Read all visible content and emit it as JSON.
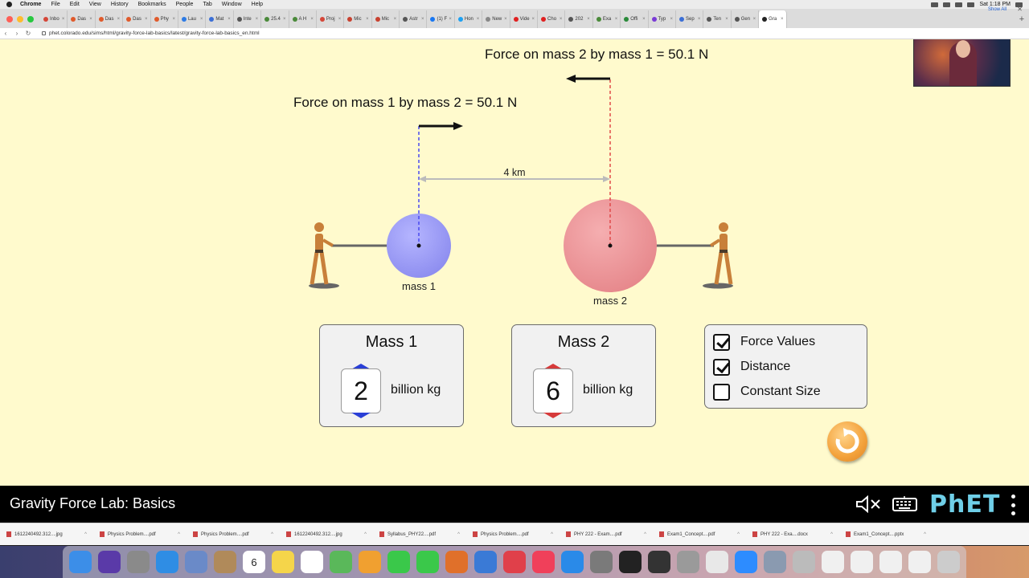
{
  "menubar": {
    "app": "Chrome",
    "items": [
      "File",
      "Edit",
      "View",
      "History",
      "Bookmarks",
      "People",
      "Tab",
      "Window",
      "Help"
    ],
    "clock": "Sat 1:18 PM"
  },
  "tabs": [
    {
      "label": "Inbo",
      "color": "#d44638"
    },
    {
      "label": "Das",
      "color": "#e05a2b"
    },
    {
      "label": "Das",
      "color": "#e05a2b"
    },
    {
      "label": "Das",
      "color": "#e05a2b"
    },
    {
      "label": "Phy",
      "color": "#e05a2b"
    },
    {
      "label": "Lau",
      "color": "#2d7be5"
    },
    {
      "label": "Mat",
      "color": "#3b6fd6"
    },
    {
      "label": "Inte",
      "color": "#555555"
    },
    {
      "label": "25.4",
      "color": "#4a8a3a"
    },
    {
      "label": "A H",
      "color": "#4a8a3a"
    },
    {
      "label": "Proj",
      "color": "#d44638"
    },
    {
      "label": "Mic",
      "color": "#c8412f"
    },
    {
      "label": "Mic",
      "color": "#c8412f"
    },
    {
      "label": "Astr",
      "color": "#555555"
    },
    {
      "label": "(1) F",
      "color": "#1877f2"
    },
    {
      "label": "Hon",
      "color": "#1da1f2"
    },
    {
      "label": "New",
      "color": "#888888"
    },
    {
      "label": "Vide",
      "color": "#e02020"
    },
    {
      "label": "Cho",
      "color": "#e02020"
    },
    {
      "label": "202",
      "color": "#555555"
    },
    {
      "label": "Exa",
      "color": "#4a8a3a"
    },
    {
      "label": "Offi",
      "color": "#2a8a3a"
    },
    {
      "label": "Typ",
      "color": "#7a3ad6"
    },
    {
      "label": "Sep",
      "color": "#3b6fd6"
    },
    {
      "label": "Ten",
      "color": "#555555"
    },
    {
      "label": "Gen",
      "color": "#555555"
    },
    {
      "label": "Gra",
      "color": "#222222",
      "active": true
    }
  ],
  "address": {
    "url": "phet.colorado.edu/sims/html/gravity-force-lab-basics/latest/gravity-force-lab-basics_en.html"
  },
  "sim": {
    "force_on_mass2": "Force on mass 2 by mass 1 = 50.1 N",
    "force_on_mass1": "Force on mass 1 by mass 2 = 50.1 N",
    "distance_label": "4 km",
    "mass1_caption": "mass 1",
    "mass2_caption": "mass 2",
    "mass1_color": "#9b9bf5",
    "mass2_color": "#eb9598",
    "mass1_panel": {
      "title": "Mass 1",
      "value": "2",
      "unit": "billion kg",
      "arrow_color": "#2a3fd6"
    },
    "mass2_panel": {
      "title": "Mass 2",
      "value": "6",
      "unit": "billion kg",
      "arrow_color": "#d63a3a"
    },
    "checkboxes": [
      {
        "label": "Force Values",
        "checked": true
      },
      {
        "label": "Distance",
        "checked": true
      },
      {
        "label": "Constant Size",
        "checked": false
      }
    ]
  },
  "navbar": {
    "title": "Gravity Force Lab: Basics",
    "logo": "PhET"
  },
  "downloads": {
    "items": [
      "1612240492.312....jpg",
      "Physics Problem....pdf",
      "Physics Problem....pdf",
      "1612240492.312....jpg",
      "Syllabus_PHY22....pdf",
      "Physics Problem....pdf",
      "PHY 222 - Exam....pdf",
      "Exam1_Concept....pdf",
      "PHY 222 - Exa....docx",
      "Exam1_Concept....pptx"
    ],
    "show_all": "Show All"
  },
  "dock": {
    "calendar_day": "6",
    "icons": [
      {
        "name": "finder-icon",
        "color": "#3c8ee8"
      },
      {
        "name": "siri-icon",
        "color": "#5a3aa8"
      },
      {
        "name": "launchpad-icon",
        "color": "#8a8a8a"
      },
      {
        "name": "safari-icon",
        "color": "#2f8de4"
      },
      {
        "name": "preview-icon",
        "color": "#6a8ac8"
      },
      {
        "name": "contacts-icon",
        "color": "#b08a5a"
      },
      {
        "name": "calendar-icon",
        "color": "#ffffff"
      },
      {
        "name": "notes-icon",
        "color": "#f5d54a"
      },
      {
        "name": "reminders-icon",
        "color": "#ffffff"
      },
      {
        "name": "maps-icon",
        "color": "#5ab85a"
      },
      {
        "name": "photos-icon",
        "color": "#f0a030"
      },
      {
        "name": "messages-icon",
        "color": "#3ac84a"
      },
      {
        "name": "facetime-icon",
        "color": "#3ac84a"
      },
      {
        "name": "numbers-icon",
        "color": "#e0702a"
      },
      {
        "name": "keynote-icon",
        "color": "#3a7ad6"
      },
      {
        "name": "news-icon",
        "color": "#e0404a"
      },
      {
        "name": "music-icon",
        "color": "#f0405a"
      },
      {
        "name": "app-store-icon",
        "color": "#2a8ae8"
      },
      {
        "name": "system-preferences-icon",
        "color": "#7a7a7a"
      },
      {
        "name": "terminal-icon",
        "color": "#222222"
      },
      {
        "name": "obs-icon",
        "color": "#333333"
      },
      {
        "name": "script-editor-icon",
        "color": "#9a9a9a"
      },
      {
        "name": "chrome-icon",
        "color": "#e8e8e8"
      },
      {
        "name": "zoom-icon",
        "color": "#2d8cff"
      },
      {
        "name": "screenshot-icon",
        "color": "#8a9ab0"
      },
      {
        "name": "printer-icon",
        "color": "#bbbbbb"
      },
      {
        "name": "document-icon",
        "color": "#f0f0f0"
      },
      {
        "name": "window-icon",
        "color": "#f0f0f0"
      },
      {
        "name": "window-icon",
        "color": "#f0f0f0"
      },
      {
        "name": "window-icon",
        "color": "#f0f0f0"
      },
      {
        "name": "trash-icon",
        "color": "#cccccc"
      }
    ]
  }
}
